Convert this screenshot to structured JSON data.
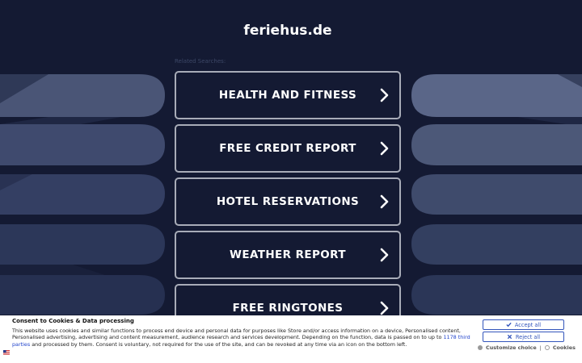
{
  "page": {
    "domain": "feriehus.de",
    "related_label": "Related Searches:"
  },
  "colors": {
    "background": "#141a33",
    "button_border": "#a8acb8",
    "accent_blue": "#3355bb",
    "left_shapes": [
      "#4a5576",
      "#3e4a6e",
      "#333f63",
      "#2b3658",
      "#252f50"
    ],
    "right_shapes": [
      "#5a6688",
      "#4c5878",
      "#3f4b6c",
      "#323e5f",
      "#2a3556"
    ]
  },
  "links": [
    {
      "label": "HEALTH AND FITNESS",
      "icon": "chevron-right-icon"
    },
    {
      "label": "FREE CREDIT REPORT",
      "icon": "chevron-right-icon"
    },
    {
      "label": "HOTEL RESERVATIONS",
      "icon": "chevron-right-icon"
    },
    {
      "label": "WEATHER REPORT",
      "icon": "chevron-right-icon"
    },
    {
      "label": "FREE RINGTONES",
      "icon": "chevron-right-icon"
    }
  ],
  "consent": {
    "title": "Consent to Cookies & Data processing",
    "text_before_link": "This website uses cookies and similar functions to process end device and personal data for purposes like Store and/or access information on a device, Personalised content, Personalised advertising, advertising and content measurement, audience research and services development. Depending on the function, data is passed on to up to ",
    "link_text": "1178 third parties",
    "text_after_link": " and processed by them. Consent is voluntary, not required for the use of the site, and can be revoked at any time via an icon on the bottom left.",
    "accept_label": "Accept all",
    "reject_label": "Reject all",
    "customize_label": "Customize choice",
    "separator": "|",
    "cookies_label": "Cookies",
    "flag_icon": "us-flag-icon"
  }
}
